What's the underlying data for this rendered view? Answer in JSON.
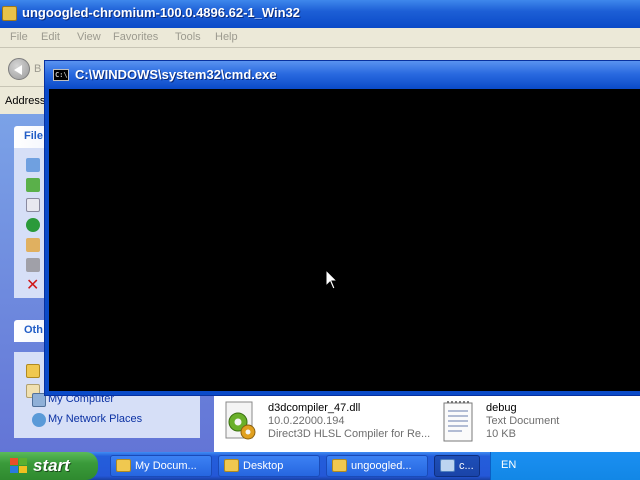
{
  "explorer": {
    "title": "ungoogled-chromium-100.0.4896.62-1_Win32",
    "menu": [
      "File",
      "Edit",
      "View",
      "Favorites",
      "Tools",
      "Help"
    ],
    "toolbar_partial": "B",
    "address_label": "Address",
    "left_pane": {
      "file_tasks_header": "File",
      "other_places_header": "Oth",
      "places": [
        "My Computer",
        "My Network Places"
      ]
    },
    "files": [
      {
        "name": "d3dcompiler_47.dll",
        "line2": "10.0.22000.194",
        "line3": "Direct3D HLSL Compiler for Re...",
        "icon": "dll-gear-icon"
      },
      {
        "name": "debug",
        "line2": "Text Document",
        "line3": "10 KB",
        "icon": "text-document-icon"
      }
    ]
  },
  "cmd": {
    "title": "C:\\WINDOWS\\system32\\cmd.exe",
    "icon_text": "C:\\"
  },
  "taskbar": {
    "start_label": "start",
    "buttons": [
      {
        "label": "My Docum..."
      },
      {
        "label": "Desktop"
      },
      {
        "label": "ungoogled..."
      },
      {
        "label": "c..."
      }
    ],
    "language": "EN"
  },
  "colors": {
    "xp_title_blue": "#0a4ac8",
    "start_green": "#3a9a3a",
    "console_bg": "#000000",
    "link_blue": "#0c32a4"
  }
}
